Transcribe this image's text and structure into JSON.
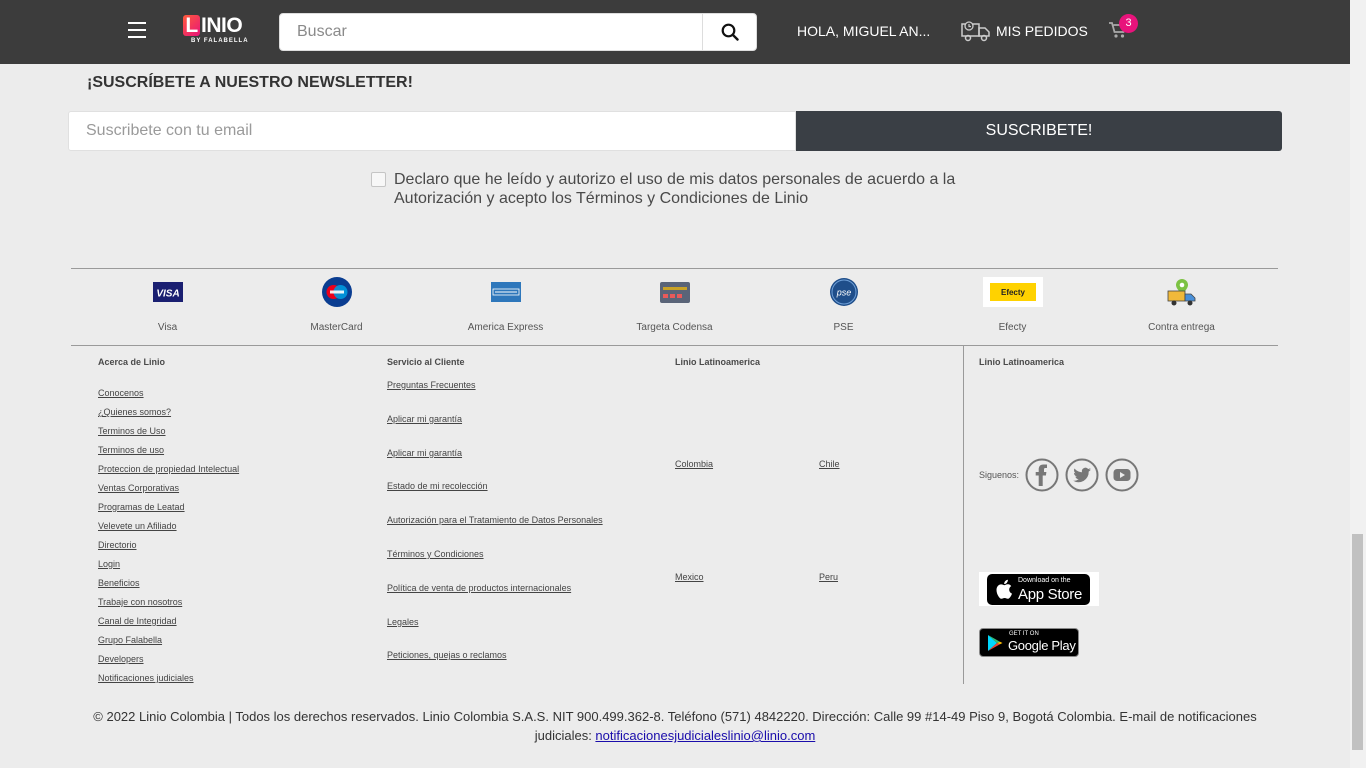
{
  "header": {
    "logo_text": "LINIO",
    "logo_sub": "BY FALABELLA",
    "search_placeholder": "Buscar",
    "greeting": "HOLA, MIGUEL AN...",
    "orders_label": "MIS PEDIDOS",
    "cart_count": "3",
    "brand_color": "#e8137b"
  },
  "newsletter": {
    "title": "¡SUSCRÍBETE A NUESTRO NEWSLETTER!",
    "email_placeholder": "Suscribete con tu email",
    "button_label": "SUSCRIBETE!",
    "consent_text": "Declaro que he leído y autorizo el uso de mis datos personales de acuerdo a la Autorización y acepto los Términos y Condiciones de Linio"
  },
  "payments": [
    {
      "label": "Visa",
      "icon": "visa-icon"
    },
    {
      "label": "MasterCard",
      "icon": "mastercard-icon"
    },
    {
      "label": "America Express",
      "icon": "amex-icon"
    },
    {
      "label": "Targeta Codensa",
      "icon": "codensa-card-icon"
    },
    {
      "label": "PSE",
      "icon": "pse-icon"
    },
    {
      "label": "Efecty",
      "icon": "efecty-icon"
    },
    {
      "label": "Contra entrega",
      "icon": "delivery-truck-icon"
    }
  ],
  "footer": {
    "about": {
      "title": "Acerca de Linio",
      "links": [
        "Conocenos",
        "¿Quienes somos?",
        "Terminos de Uso",
        "Terminos de uso",
        "Proteccion de propiedad Intelectual",
        "Ventas Corporativas",
        "Programas de Leatad",
        "Velevete un Afiliado",
        "Directorio",
        "Login",
        "Beneficios",
        "Trabaje con nosotros",
        "Canal de Integridad",
        "Grupo Falabella",
        "Developers",
        "Notificaciones judiciales"
      ]
    },
    "service": {
      "title": "Servicio al Cliente",
      "links": [
        "Preguntas Frecuentes",
        "Aplicar mi garantía",
        "Aplicar mi garantía",
        "Estado de mi recolección",
        "Autorización para el Tratamiento de Datos Personales",
        "Términos y Condiciones",
        "Política de venta de productos internacionales",
        "Legales",
        "Peticiones, quejas o reclamos"
      ]
    },
    "latam": {
      "title": "Linio Latinoamerica",
      "countries": [
        "Colombia",
        "Chile",
        "Mexico",
        "Peru"
      ]
    },
    "social": {
      "title": "Linio Latinoamerica",
      "follow_label": "Siguenos:",
      "icons": [
        "facebook-icon",
        "twitter-icon",
        "youtube-icon"
      ],
      "appstore_small": "Download on the",
      "appstore_big": "App Store",
      "gplay_small": "GET IT ON",
      "gplay_big": "Google Play"
    },
    "copyright_text": "© 2022 Linio Colombia | Todos los derechos reservados. Linio Colombia S.A.S. NIT 900.499.362-8. Teléfono (571) 4842220. Dirección: Calle 99 #14-49 Piso 9, Bogotá Colombia. E-mail de notificaciones judiciales: ",
    "copyright_email": "notificacionesjudicialeslinio@linio.com"
  }
}
